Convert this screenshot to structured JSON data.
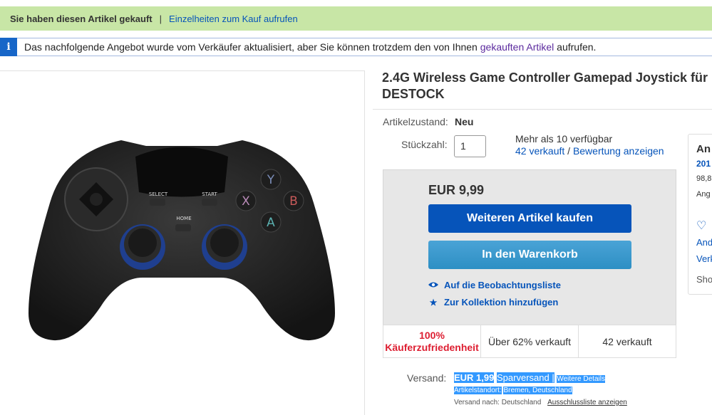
{
  "banner": {
    "purchased": "Sie haben diesen Artikel gekauft",
    "separator": "|",
    "details_link": "Einzelheiten zum Kauf aufrufen"
  },
  "info": {
    "icon": "i",
    "text_before": "Das nachfolgende Angebot wurde vom Verkäufer aktualisiert, aber Sie können trotzdem den von Ihnen",
    "link": "gekauften Artikel",
    "text_after": "aufrufen."
  },
  "product": {
    "title_line1": "2.4G Wireless Game Controller Gamepad Joystick für",
    "title_line2": "DESTOCK",
    "condition_label": "Artikelzustand:",
    "condition_value": "Neu",
    "quantity_label": "Stückzahl:",
    "quantity_value": "1",
    "availability": "Mehr als 10 verfügbar",
    "sold_link": "42 verkauft",
    "sold_sep": "/",
    "rating_link": "Bewertung anzeigen",
    "image_labels": {
      "select": "SELECT",
      "start": "START",
      "home": "HOME",
      "y": "Y",
      "x": "X",
      "b": "B",
      "a": "A"
    }
  },
  "buybox": {
    "price": "EUR 9,99",
    "buy_button": "Weiteren Artikel kaufen",
    "cart_button": "In den Warenkorb",
    "watchlist": "Auf die Beobachtungsliste",
    "collection": "Zur Kollektion hinzufügen",
    "stats": {
      "satisfaction_pct": "100%",
      "satisfaction_label": "Käuferzufriedenheit",
      "sold_pct": "Über 62% verkauft",
      "sold_count": "42 verkauft"
    }
  },
  "shipping": {
    "label": "Versand:",
    "price": "EUR 1,99",
    "method": "Sparversand |",
    "details": "Weitere Details",
    "location_label": "Artikelstandort:",
    "location": "Bremen, Deutschland",
    "ship_to_label": "Versand nach:",
    "ship_to": "Deutschland",
    "exclusions": "Ausschlussliste anzeigen"
  },
  "seller": {
    "heading": "An",
    "feedback_count": "201",
    "rating": "98,8",
    "line": "Ang",
    "link1": "And",
    "link2": "Verk",
    "shop": "Sho"
  },
  "colors": {
    "success_banner": "#c8e6a6",
    "info_blue": "#1766c8",
    "buy_button": "#0654ba",
    "cart_button": "#3498ca",
    "link": "#0654ba",
    "satisfaction_red": "#dd1e31",
    "selection": "#3399ff"
  }
}
